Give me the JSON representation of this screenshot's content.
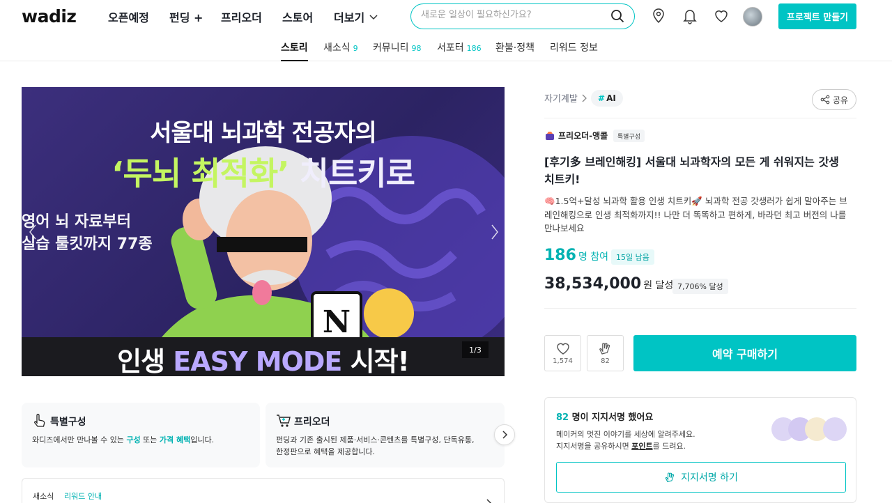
{
  "header": {
    "logo": "wadiz",
    "nav": [
      "오픈예정",
      "펀딩 +",
      "프리오더",
      "스토어",
      "더보기"
    ],
    "search_placeholder": "새로운 일상이 필요하신가요?",
    "create_project": "프로젝트 만들기"
  },
  "tabs": [
    {
      "label": "스토리",
      "count": ""
    },
    {
      "label": "새소식",
      "count": "9"
    },
    {
      "label": "커뮤니티",
      "count": "98"
    },
    {
      "label": "서포터",
      "count": "186"
    },
    {
      "label": "환불·정책",
      "count": ""
    },
    {
      "label": "리워드 정보",
      "count": ""
    }
  ],
  "hero": {
    "line1": "서울대 뇌과학 전공자의",
    "line2_green": "‘두뇌 최적화’",
    "line2_white": "치트키로",
    "side_line1": "영어 뇌 자료부터",
    "side_line2": "실습 툴킷까지 77종",
    "band_prefix": "인생",
    "band_highlight": "EASY MODE",
    "band_suffix": "시작!",
    "counter": "1/3"
  },
  "cards": [
    {
      "title": "특별구성",
      "desc_pre": "와디즈에서만 만나볼 수 있는 ",
      "hl1": "구성",
      "desc_mid": " 또는 ",
      "hl2": "가격 혜택",
      "desc_post": "입니다."
    },
    {
      "title": "프리오더",
      "desc_line1": "펀딩과 기존 출시된 제품·서비스·콘텐츠를 특별구성, 단독유통,",
      "desc_line2": "한정판으로 혜택을 제공합니다."
    }
  ],
  "news": {
    "label": "새소식",
    "link": "리워드 안내"
  },
  "project": {
    "category": "자기계발",
    "tag": "AI",
    "share": "공유",
    "maker": "프리오더-앵콜",
    "maker_badge": "특별구성",
    "title": "[후기多 브레인해킹] 서울대 뇌과학자의 모든 게 쉬워지는 갓생 치트키!",
    "description": "🧠1.5억+달성 뇌과학 활용 인생 치트키🚀 뇌과학 전공 갓생러가 쉽게 말아주는 브레인해킹으로 인생 최적화까지!! 나만 더 똑똑하고 편하게, 바라던 최고 버전의 나를 만나보세요",
    "supporters": "186",
    "supporters_unit": "명 참여",
    "days_left": "15일 남음",
    "amount": "38,534,000",
    "amount_unit": "원 달성",
    "rate": "7,706% 달성",
    "likes": "1,574",
    "cheers": "82",
    "buy": "예약 구매하기"
  },
  "signature": {
    "count": "82",
    "title_suffix": " 명이 지지서명 했어요",
    "desc_line1": "메이커의 멋진 이야기를 세상에 알려주세요.",
    "desc_pre": "지지서명을 공유하시면 ",
    "desc_point": "포인트",
    "desc_post": "를 드려요.",
    "button": "지지서명 하기"
  },
  "colors": {
    "accent": "#00c4c4",
    "hero_bg": "#2c2363",
    "hero_green": "#c4f561"
  }
}
